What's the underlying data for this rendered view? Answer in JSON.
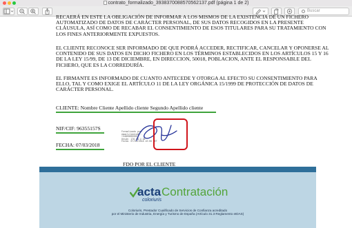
{
  "window": {
    "title": "contrato_formalizado_3938370088570562137.pdf (página 1 de 2)"
  },
  "toolbar": {
    "search_placeholder": "Buscar",
    "search_icon": "magnifier"
  },
  "document": {
    "paragraph1": "recaerá en este la obligación de informar a los mismos de la existencia de un fichero automatizado de datos de carácter personal, de sus datos recogidos en la presente cláusula, así como de recabar el consentimiento de esos titulares para su tratamiento con los fines anteriormente expuestos.",
    "paragraph2": "El cliente reconoce ser informado de que podrá acceder, rectificar, cancelar y oponerse al contenido de sus datos en dicho fichero en los términos establecidos en los artículos 15 y 16 de la ley 15/99, de 13 de diciembre, en direccion, 50018, poblacion, ante el responsable del fichero, que es la correduría.",
    "paragraph3": "El firmante es informado de cuanto antecede y otorga al efecto su consentimiento para ello, tal y como exige el artículo 11 de la ley orgánica 15/1999 de protección de datos de carácter personal.",
    "client_line": "CLIENTE: Nombre Cliente Apellido cliente Segundo Apellido cliente",
    "nif_line": "NIF/CIF: 96355157S",
    "fecha_line": "FECHA: 07/03/2018",
    "firma_line": "FDO POR EL CLIENTE",
    "stamp": {
      "line1": "Formalizado por:",
      "line2": "emailcliente@...",
      "line3": "+34600000000",
      "line4": "Desde: 176.83.2.36",
      "line5": "Fecha: 07/03/2018 10:08 CET"
    },
    "banner": {
      "logo_acta": "acta",
      "logo_contratacion": "Contratación",
      "logo_sub": "coloriuris",
      "text1": "Coloriuris, Prestador Cualificado de Servicios de Confianza acreditado",
      "text2": "por el Ministerio de Industria, Energía y Turismo de España (Artículo 31.3 Reglamento eIDAS)"
    }
  },
  "colors": {
    "underline_green": "#3da33a",
    "signature_box_red": "#d0131a",
    "banner_background": "#bdd6e4",
    "banner_bar": "#2f6f9a",
    "logo_blue": "#1a3f78",
    "logo_green": "#53a43a"
  }
}
